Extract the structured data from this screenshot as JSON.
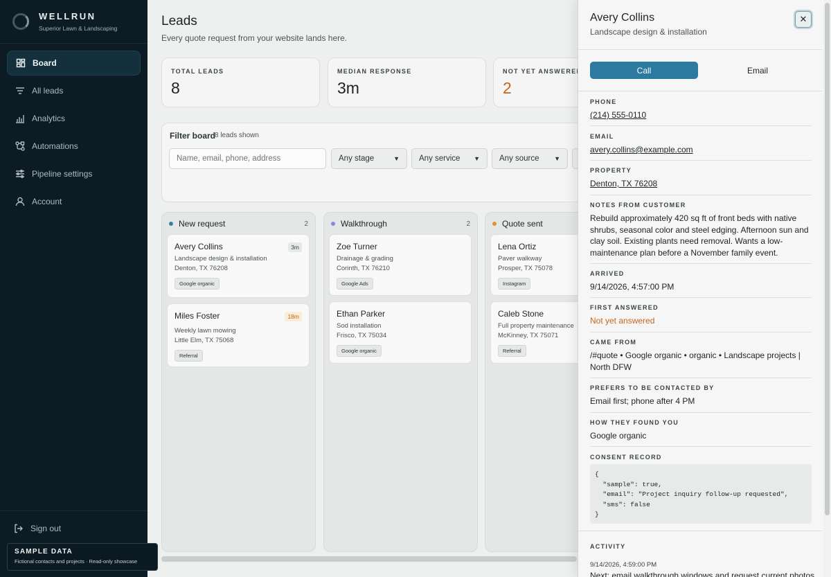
{
  "brand": {
    "name": "WELLRUN",
    "subtitle": "Superior Lawn & Landscaping"
  },
  "nav": [
    {
      "label": "Board",
      "icon": "board-icon",
      "active": true
    },
    {
      "label": "All leads",
      "icon": "filter-lines-icon"
    },
    {
      "label": "Analytics",
      "icon": "bar-chart-icon"
    },
    {
      "label": "Automations",
      "icon": "automation-nodes-icon"
    },
    {
      "label": "Pipeline settings",
      "icon": "sliders-icon"
    },
    {
      "label": "Account",
      "icon": "user-icon"
    }
  ],
  "sign_out": "Sign out",
  "sample": {
    "title": "SAMPLE DATA",
    "subtitle": "Fictional contacts and projects · Read-only showcase"
  },
  "page": {
    "title": "Leads",
    "subtitle": "Every quote request from your website lands here."
  },
  "stats": [
    {
      "label": "TOTAL LEADS",
      "value": "8"
    },
    {
      "label": "MEDIAN RESPONSE",
      "value": "3m"
    },
    {
      "label": "NOT YET ANSWERED",
      "value": "2",
      "warn": true
    }
  ],
  "filter": {
    "title": "Filter board",
    "count": "8 leads shown",
    "search_placeholder": "Name, email, phone, address",
    "selects": [
      "Any stage",
      "Any service",
      "Any source"
    ]
  },
  "columns": [
    {
      "title": "New request",
      "count": "2",
      "color": "#3b7fa3",
      "cards": [
        {
          "name": "Avery Collins",
          "service": "Landscape design & installation",
          "address": "Denton, TX 76208",
          "source": "Google organic",
          "age": "3m",
          "age_warm": false
        },
        {
          "name": "Miles Foster",
          "service": "Weekly lawn mowing",
          "address": "Little Elm, TX 75068",
          "source": "Referral",
          "age": "18m",
          "age_warm": true
        }
      ]
    },
    {
      "title": "Walkthrough",
      "count": "2",
      "color": "#8f86d6",
      "cards": [
        {
          "name": "Zoe Turner",
          "service": "Drainage & grading",
          "address": "Corinth, TX 76210",
          "source": "Google Ads"
        },
        {
          "name": "Ethan Parker",
          "service": "Sod installation",
          "address": "Frisco, TX 75034",
          "source": "Google organic"
        }
      ]
    },
    {
      "title": "Quote sent",
      "count": "",
      "color": "#e0952f",
      "cards": [
        {
          "name": "Lena Ortiz",
          "service": "Paver walkway",
          "address": "Prosper, TX 75078",
          "source": "Instagram"
        },
        {
          "name": "Caleb Stone",
          "service": "Full property maintenance",
          "address": "McKinney, TX 75071",
          "source": "Referral"
        }
      ]
    }
  ],
  "panel": {
    "name": "Avery Collins",
    "subtitle": "Landscape design & installation",
    "close_icon": "close-icon",
    "call_label": "Call",
    "email_label": "Email",
    "phone_label": "PHONE",
    "phone": "(214) 555-0110",
    "email_field_label": "EMAIL",
    "email": "avery.collins@example.com",
    "property_label": "PROPERTY",
    "property": "Denton, TX 76208",
    "notes_label": "NOTES FROM CUSTOMER",
    "notes": "Rebuild approximately 420 sq ft of front beds with native shrubs, seasonal color and steel edging. Afternoon sun and clay soil. Existing plants need removal. Wants a low-maintenance plan before a November family event.",
    "arrived_label": "ARRIVED",
    "arrived": "9/14/2026, 4:57:00 PM",
    "first_answered_label": "FIRST ANSWERED",
    "first_answered": "Not yet answered",
    "came_from_label": "CAME FROM",
    "came_from": "/#quote • Google organic • organic • Landscape projects | North DFW",
    "prefers_label": "PREFERS TO BE CONTACTED BY",
    "prefers": "Email first; phone after 4 PM",
    "found_label": "HOW THEY FOUND YOU",
    "found": "Google organic",
    "consent_label": "CONSENT RECORD",
    "consent": "{\n  \"sample\": true,\n  \"email\": \"Project inquiry follow-up requested\",\n  \"sms\": false\n}",
    "activity_label": "ACTIVITY",
    "activity_date": "9/14/2026, 4:59:00 PM",
    "activity_text": "Next: email walkthrough windows and request current photos."
  },
  "colors": {
    "accent": "#2c7aa0",
    "warn": "#c8651b",
    "sidebar": "#0d1c24"
  }
}
